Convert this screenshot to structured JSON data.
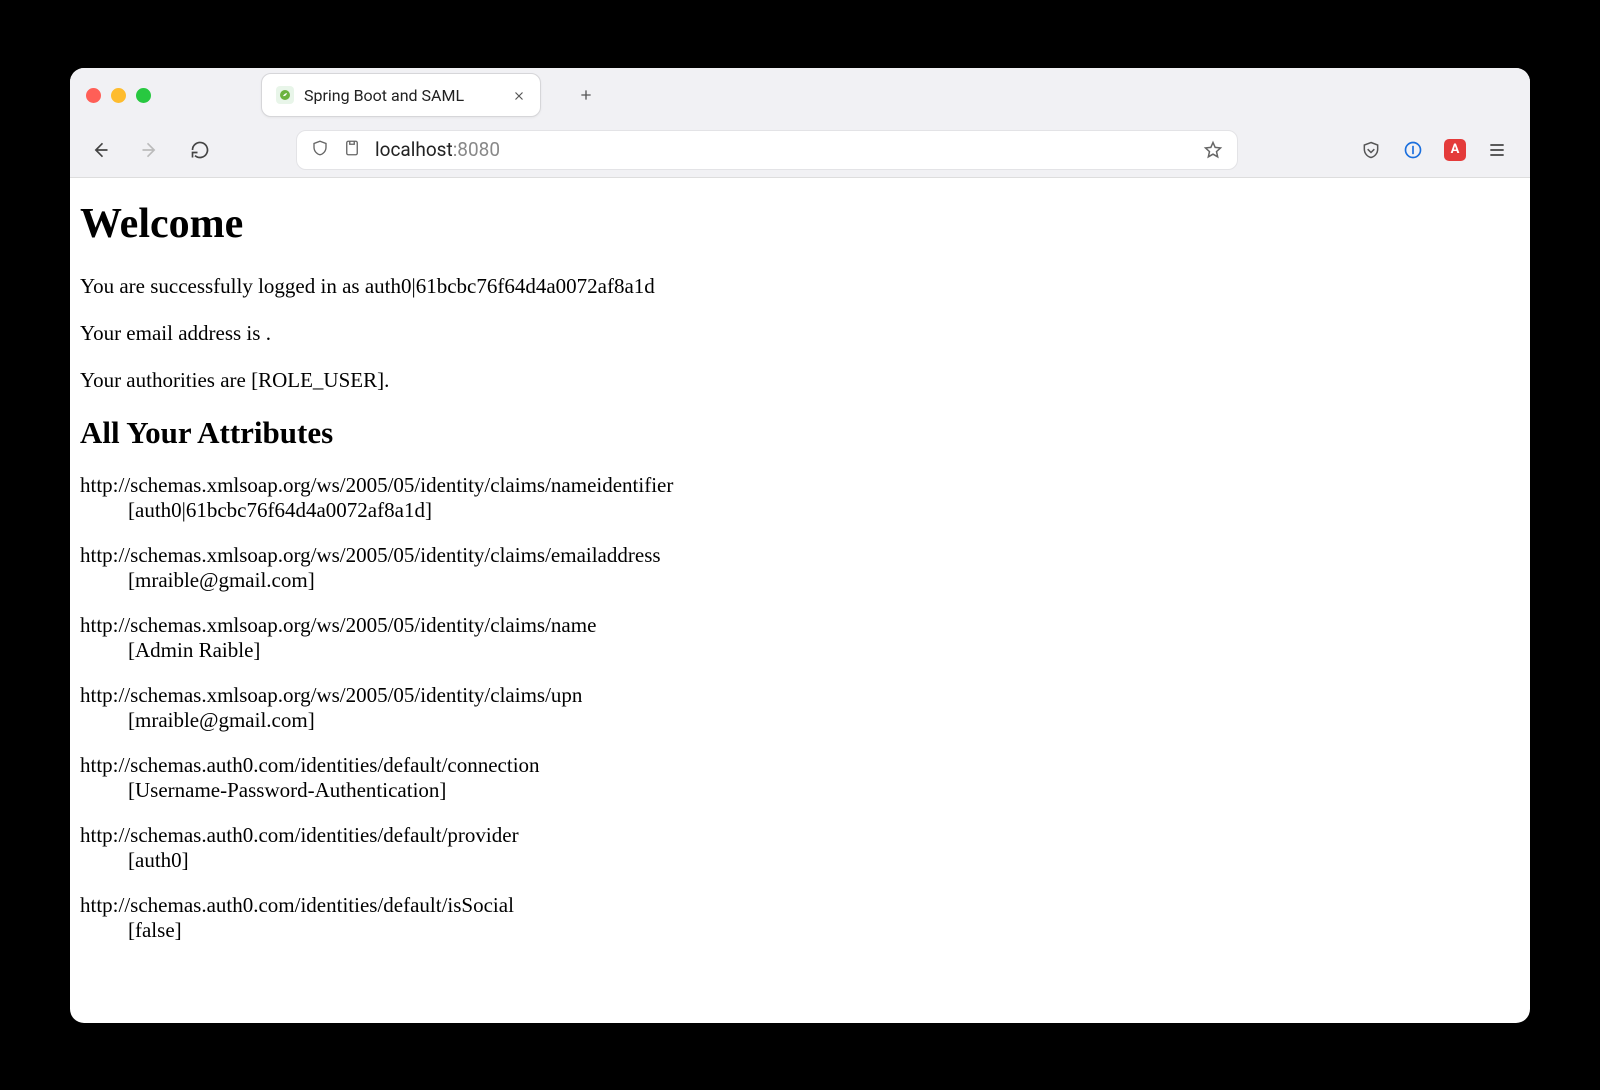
{
  "tab": {
    "title": "Spring Boot and SAML"
  },
  "url": {
    "host": "localhost",
    "port": ":8080"
  },
  "page": {
    "heading": "Welcome",
    "loggedInPrefix": "You are successfully logged in as ",
    "username": "auth0|61bcbc76f64d4a0072af8a1d",
    "emailLinePrefix": "Your email address is ",
    "emailValue": "",
    "emailLineSuffix": ".",
    "authoritiesLinePrefix": "Your authorities are ",
    "authorities": "[ROLE_USER]",
    "authoritiesLineSuffix": ".",
    "attributesHeading": "All Your Attributes",
    "attributes": [
      {
        "name": "http://schemas.xmlsoap.org/ws/2005/05/identity/claims/nameidentifier",
        "value": "[auth0|61bcbc76f64d4a0072af8a1d]"
      },
      {
        "name": "http://schemas.xmlsoap.org/ws/2005/05/identity/claims/emailaddress",
        "value": "[mraible@gmail.com]"
      },
      {
        "name": "http://schemas.xmlsoap.org/ws/2005/05/identity/claims/name",
        "value": "[Admin Raible]"
      },
      {
        "name": "http://schemas.xmlsoap.org/ws/2005/05/identity/claims/upn",
        "value": "[mraible@gmail.com]"
      },
      {
        "name": "http://schemas.auth0.com/identities/default/connection",
        "value": "[Username-Password-Authentication]"
      },
      {
        "name": "http://schemas.auth0.com/identities/default/provider",
        "value": "[auth0]"
      },
      {
        "name": "http://schemas.auth0.com/identities/default/isSocial",
        "value": "[false]"
      }
    ]
  },
  "extBadge": "A"
}
